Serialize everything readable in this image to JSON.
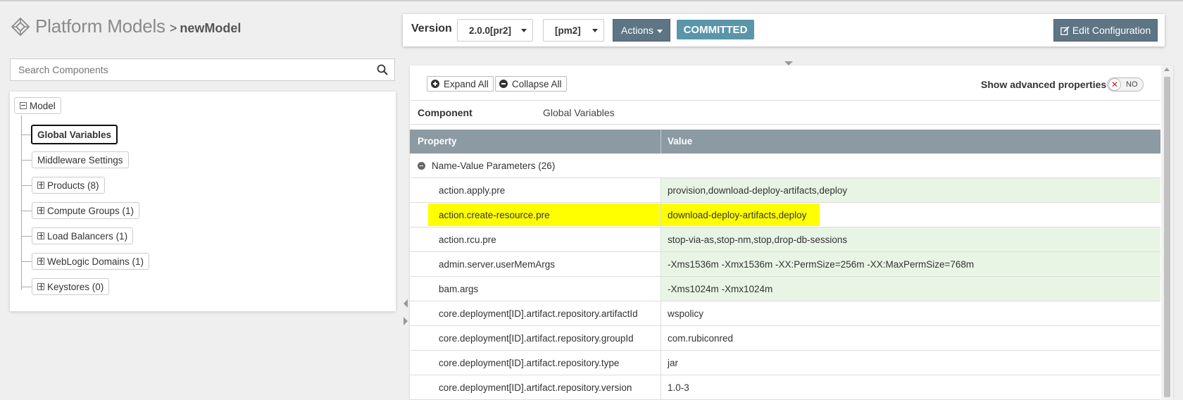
{
  "header": {
    "app_title": "Platform Models",
    "separator": ">",
    "model_name": "newModel"
  },
  "search": {
    "placeholder": "Search Components"
  },
  "tree": {
    "root": "Model",
    "items": [
      {
        "label": "Global Variables",
        "selected": true
      },
      {
        "label": "Middleware Settings"
      },
      {
        "label": "Products (8)"
      },
      {
        "label": "Compute Groups (1)"
      },
      {
        "label": "Load Balancers (1)"
      },
      {
        "label": "WebLogic Domains (1)"
      },
      {
        "label": "Keystores (0)"
      }
    ]
  },
  "topbar": {
    "version_label": "Version",
    "version_value": "2.0.0[pr2]",
    "release_value": "[pm2]",
    "actions_label": "Actions",
    "status_badge": "COMMITTED",
    "edit_label": "Edit Configuration"
  },
  "toolbar": {
    "expand_all": "Expand All",
    "collapse_all": "Collapse All",
    "advanced_label": "Show advanced properties",
    "toggle_text": "NO"
  },
  "component": {
    "label": "Component",
    "value": "Global Variables"
  },
  "table": {
    "headers": [
      "Property",
      "Value"
    ],
    "group": "Name-Value Parameters (26)",
    "rows": [
      {
        "property": "action.apply.pre",
        "value": "provision,download-deploy-artifacts,deploy"
      },
      {
        "property": "action.create-resource.pre",
        "value": "download-deploy-artifacts,deploy"
      },
      {
        "property": "action.rcu.pre",
        "value": "stop-via-as,stop-nm,stop,drop-db-sessions"
      },
      {
        "property": "admin.server.userMemArgs",
        "value": "-Xms1536m -Xmx1536m -XX:PermSize=256m -XX:MaxPermSize=768m"
      },
      {
        "property": "bam.args",
        "value": "-Xms1024m -Xmx1024m"
      },
      {
        "property": "core.deployment[ID].artifact.repository.artifactId",
        "value": "wspolicy"
      },
      {
        "property": "core.deployment[ID].artifact.repository.groupId",
        "value": "com.rubiconred"
      },
      {
        "property": "core.deployment[ID].artifact.repository.type",
        "value": "jar"
      },
      {
        "property": "core.deployment[ID].artifact.repository.version",
        "value": "1.0-3"
      }
    ]
  },
  "colors": {
    "button_bg": "#5e7585",
    "badge_bg": "#5a95aa",
    "table_header_bg": "#8c9aa3",
    "modified_row_bg": "#e8f5e4",
    "highlight": "#ffff00"
  }
}
